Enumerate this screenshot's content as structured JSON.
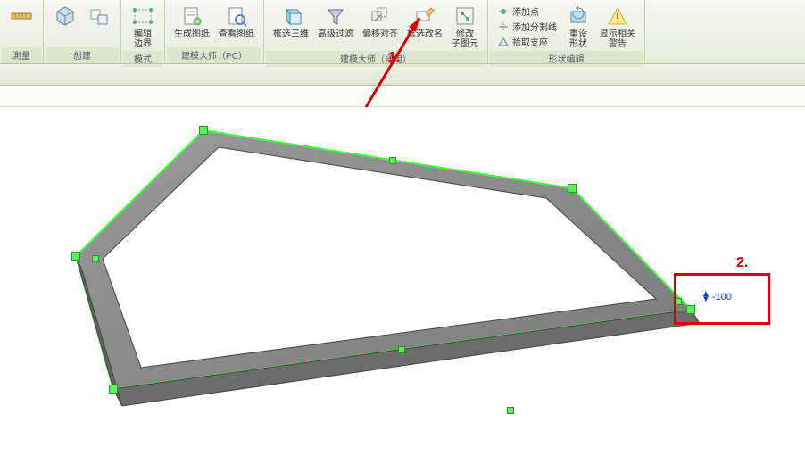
{
  "ribbon": {
    "groups": [
      {
        "label": "測量",
        "items": [
          {
            "name": "measure",
            "label": ""
          }
        ]
      },
      {
        "label": "创建",
        "items": [
          {
            "name": "create-a",
            "label": ""
          },
          {
            "name": "create-b",
            "label": ""
          }
        ]
      },
      {
        "label": "模式",
        "items": [
          {
            "name": "edit-boundary",
            "label": "编辑\n边界"
          }
        ]
      },
      {
        "label": "建模大师（PC）",
        "items": [
          {
            "name": "gen-drawing",
            "label": "生成图纸"
          },
          {
            "name": "view-drawing",
            "label": "查看图纸"
          }
        ]
      },
      {
        "label": "建模大师（通用）",
        "items": [
          {
            "name": "box-3d",
            "label": "框选三维"
          },
          {
            "name": "adv-filter",
            "label": "高级过滤"
          },
          {
            "name": "offset-align",
            "label": "偏移对齐"
          },
          {
            "name": "box-rename",
            "label": "框选改名"
          },
          {
            "name": "edit-subelem",
            "label": "修改\n子图元"
          }
        ]
      },
      {
        "label": "形状编辑",
        "small": [
          {
            "name": "add-point",
            "label": "添加点"
          },
          {
            "name": "add-split",
            "label": "添加分割线"
          },
          {
            "name": "pick-support",
            "label": "拾取支座"
          }
        ],
        "items": [
          {
            "name": "reset-shape",
            "label": "重设\n形状"
          },
          {
            "name": "show-warn",
            "label": "显示相关\n警告"
          }
        ]
      }
    ]
  },
  "annotations": {
    "arrow1_label": "1.",
    "box2_label": "2.",
    "dimension_value": "-100"
  }
}
